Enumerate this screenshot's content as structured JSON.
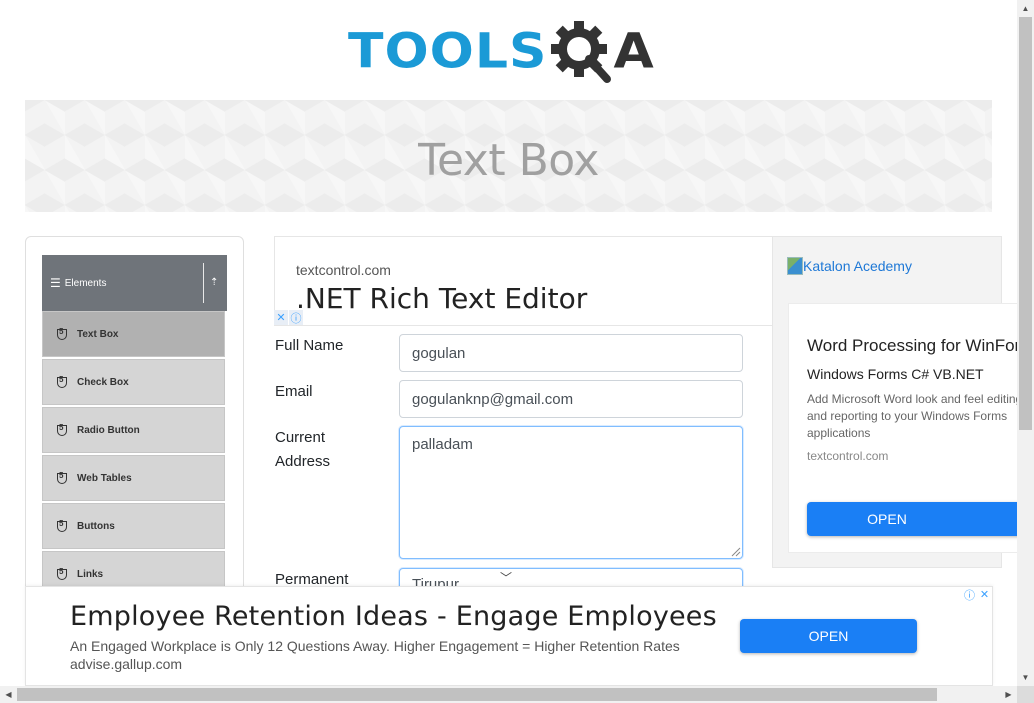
{
  "logo": {
    "text_main": "TOOLS",
    "text_tail": "A",
    "brand_color": "#1b9ad6",
    "dark_color": "#333333"
  },
  "banner": {
    "title": "Text Box"
  },
  "sidebar": {
    "group_title": "Elements",
    "items": [
      {
        "label": "Text Box",
        "active": true
      },
      {
        "label": "Check Box",
        "active": false
      },
      {
        "label": "Radio Button",
        "active": false
      },
      {
        "label": "Web Tables",
        "active": false
      },
      {
        "label": "Buttons",
        "active": false
      },
      {
        "label": "Links",
        "active": false
      }
    ]
  },
  "ad_top": {
    "domain": "textcontrol.com",
    "title": ".NET Rich Text Editor"
  },
  "form": {
    "full_name_label": "Full Name",
    "full_name_value": "gogulan",
    "email_label": "Email",
    "email_value": "gogulanknp@gmail.com",
    "current_address_label_1": "Current",
    "current_address_label_2": "Address",
    "current_address_value": "palladam",
    "permanent_address_label": "Permanent",
    "permanent_address_value": "Tirupur"
  },
  "ad_right": {
    "broken_image_alt": "Katalon Acedemy",
    "title": "Word Processing for WinForms",
    "subtitle": "Windows Forms C# VB.NET",
    "desc_line1": "Add Microsoft Word look and feel editing",
    "desc_line2": "and reporting to your Windows Forms",
    "desc_line3": "applications",
    "domain": "textcontrol.com",
    "open_label": "OPEN"
  },
  "ad_bottom": {
    "title": "Employee Retention Ideas - Engage Employees",
    "desc": "An Engaged Workplace is Only 12 Questions Away. Higher Engagement = Higher Retention Rates",
    "domain": "advise.gallup.com",
    "open_label": "OPEN"
  },
  "colors": {
    "accent": "#1a7ff5",
    "sidebar_header": "#6f747a",
    "sidebar_item": "#d5d5d5",
    "sidebar_active": "#b1b1b1"
  }
}
